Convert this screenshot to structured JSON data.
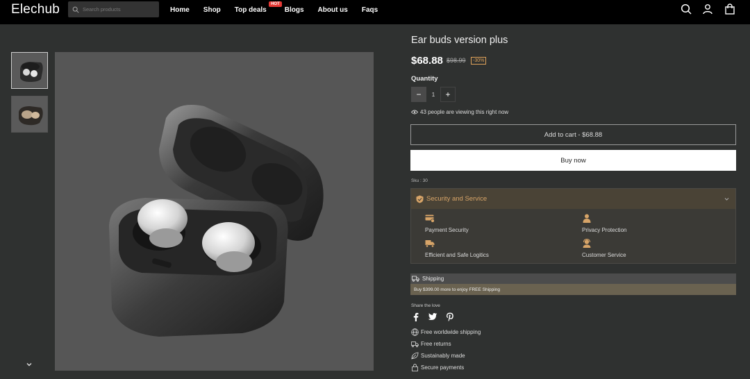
{
  "header": {
    "logo": "Elechub",
    "search_placeholder": "Search products",
    "nav": [
      "Home",
      "Shop",
      "Top deals",
      "Blogs",
      "About us",
      "Faqs"
    ],
    "hot_badge": "HOT"
  },
  "product": {
    "title": "Ear buds version plus",
    "price": "$68.88",
    "old_price": "$98.99",
    "discount": "-30%",
    "quantity_label": "Quantity",
    "quantity": "1",
    "viewing": "43 people are viewing this right now",
    "add_to_cart": "Add to cart  -  $68.88",
    "buy_now": "Buy now",
    "sku": "Sku : 30"
  },
  "security": {
    "heading": "Security and Service",
    "items": [
      "Payment Security",
      "Privacy Protection",
      "Efficient and Safe Logitics",
      "Customer Service"
    ]
  },
  "shipping": {
    "label": "Shipping",
    "note": "Buy $399.00 more to enjoy FREE Shipping"
  },
  "share": {
    "label": "Share the love"
  },
  "features": [
    "Free worldwide shipping",
    "Free returns",
    "Sustainably made",
    "Secure payments"
  ],
  "colors": {
    "accent": "#d7a468",
    "hot": "#e53935",
    "background": "#2f3130"
  }
}
